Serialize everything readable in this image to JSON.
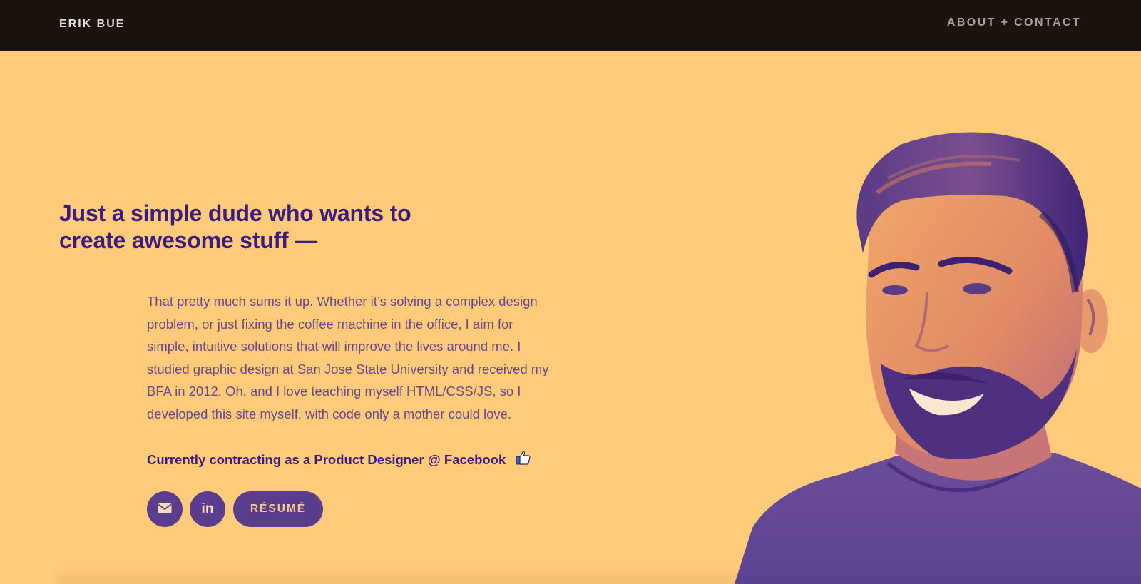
{
  "nav": {
    "brand": "ERIK BUE",
    "link": "ABOUT + CONTACT"
  },
  "hero": {
    "headline": "Just a simple dude who wants to create awesome stuff —",
    "bio": "That pretty much sums it up. Whether it’s solving a complex design problem, or just fixing the coffee machine in the office, I aim for simple, intuitive solutions that will improve the lives around me. I studied graphic design at San Jose State University and received my BFA in 2012. Oh, and I love teaching myself HTML/CSS/JS, so I developed this site myself, with code only a mother could love.",
    "current": "Currently contracting as a Product Designer @ Facebook",
    "current_icon": "thumbs-up-icon",
    "buttons": {
      "email_icon": "envelope-icon",
      "linkedin_icon": "linkedin-icon",
      "linkedin_text": "in",
      "resume": "RÉSUMÉ"
    },
    "portrait_icon": "portrait-photo"
  },
  "colors": {
    "background": "#fecb7b",
    "topbar": "#1b130e",
    "headline": "#3c1d7f",
    "body_text": "#6a4a86",
    "button": "#5a3e8d"
  }
}
